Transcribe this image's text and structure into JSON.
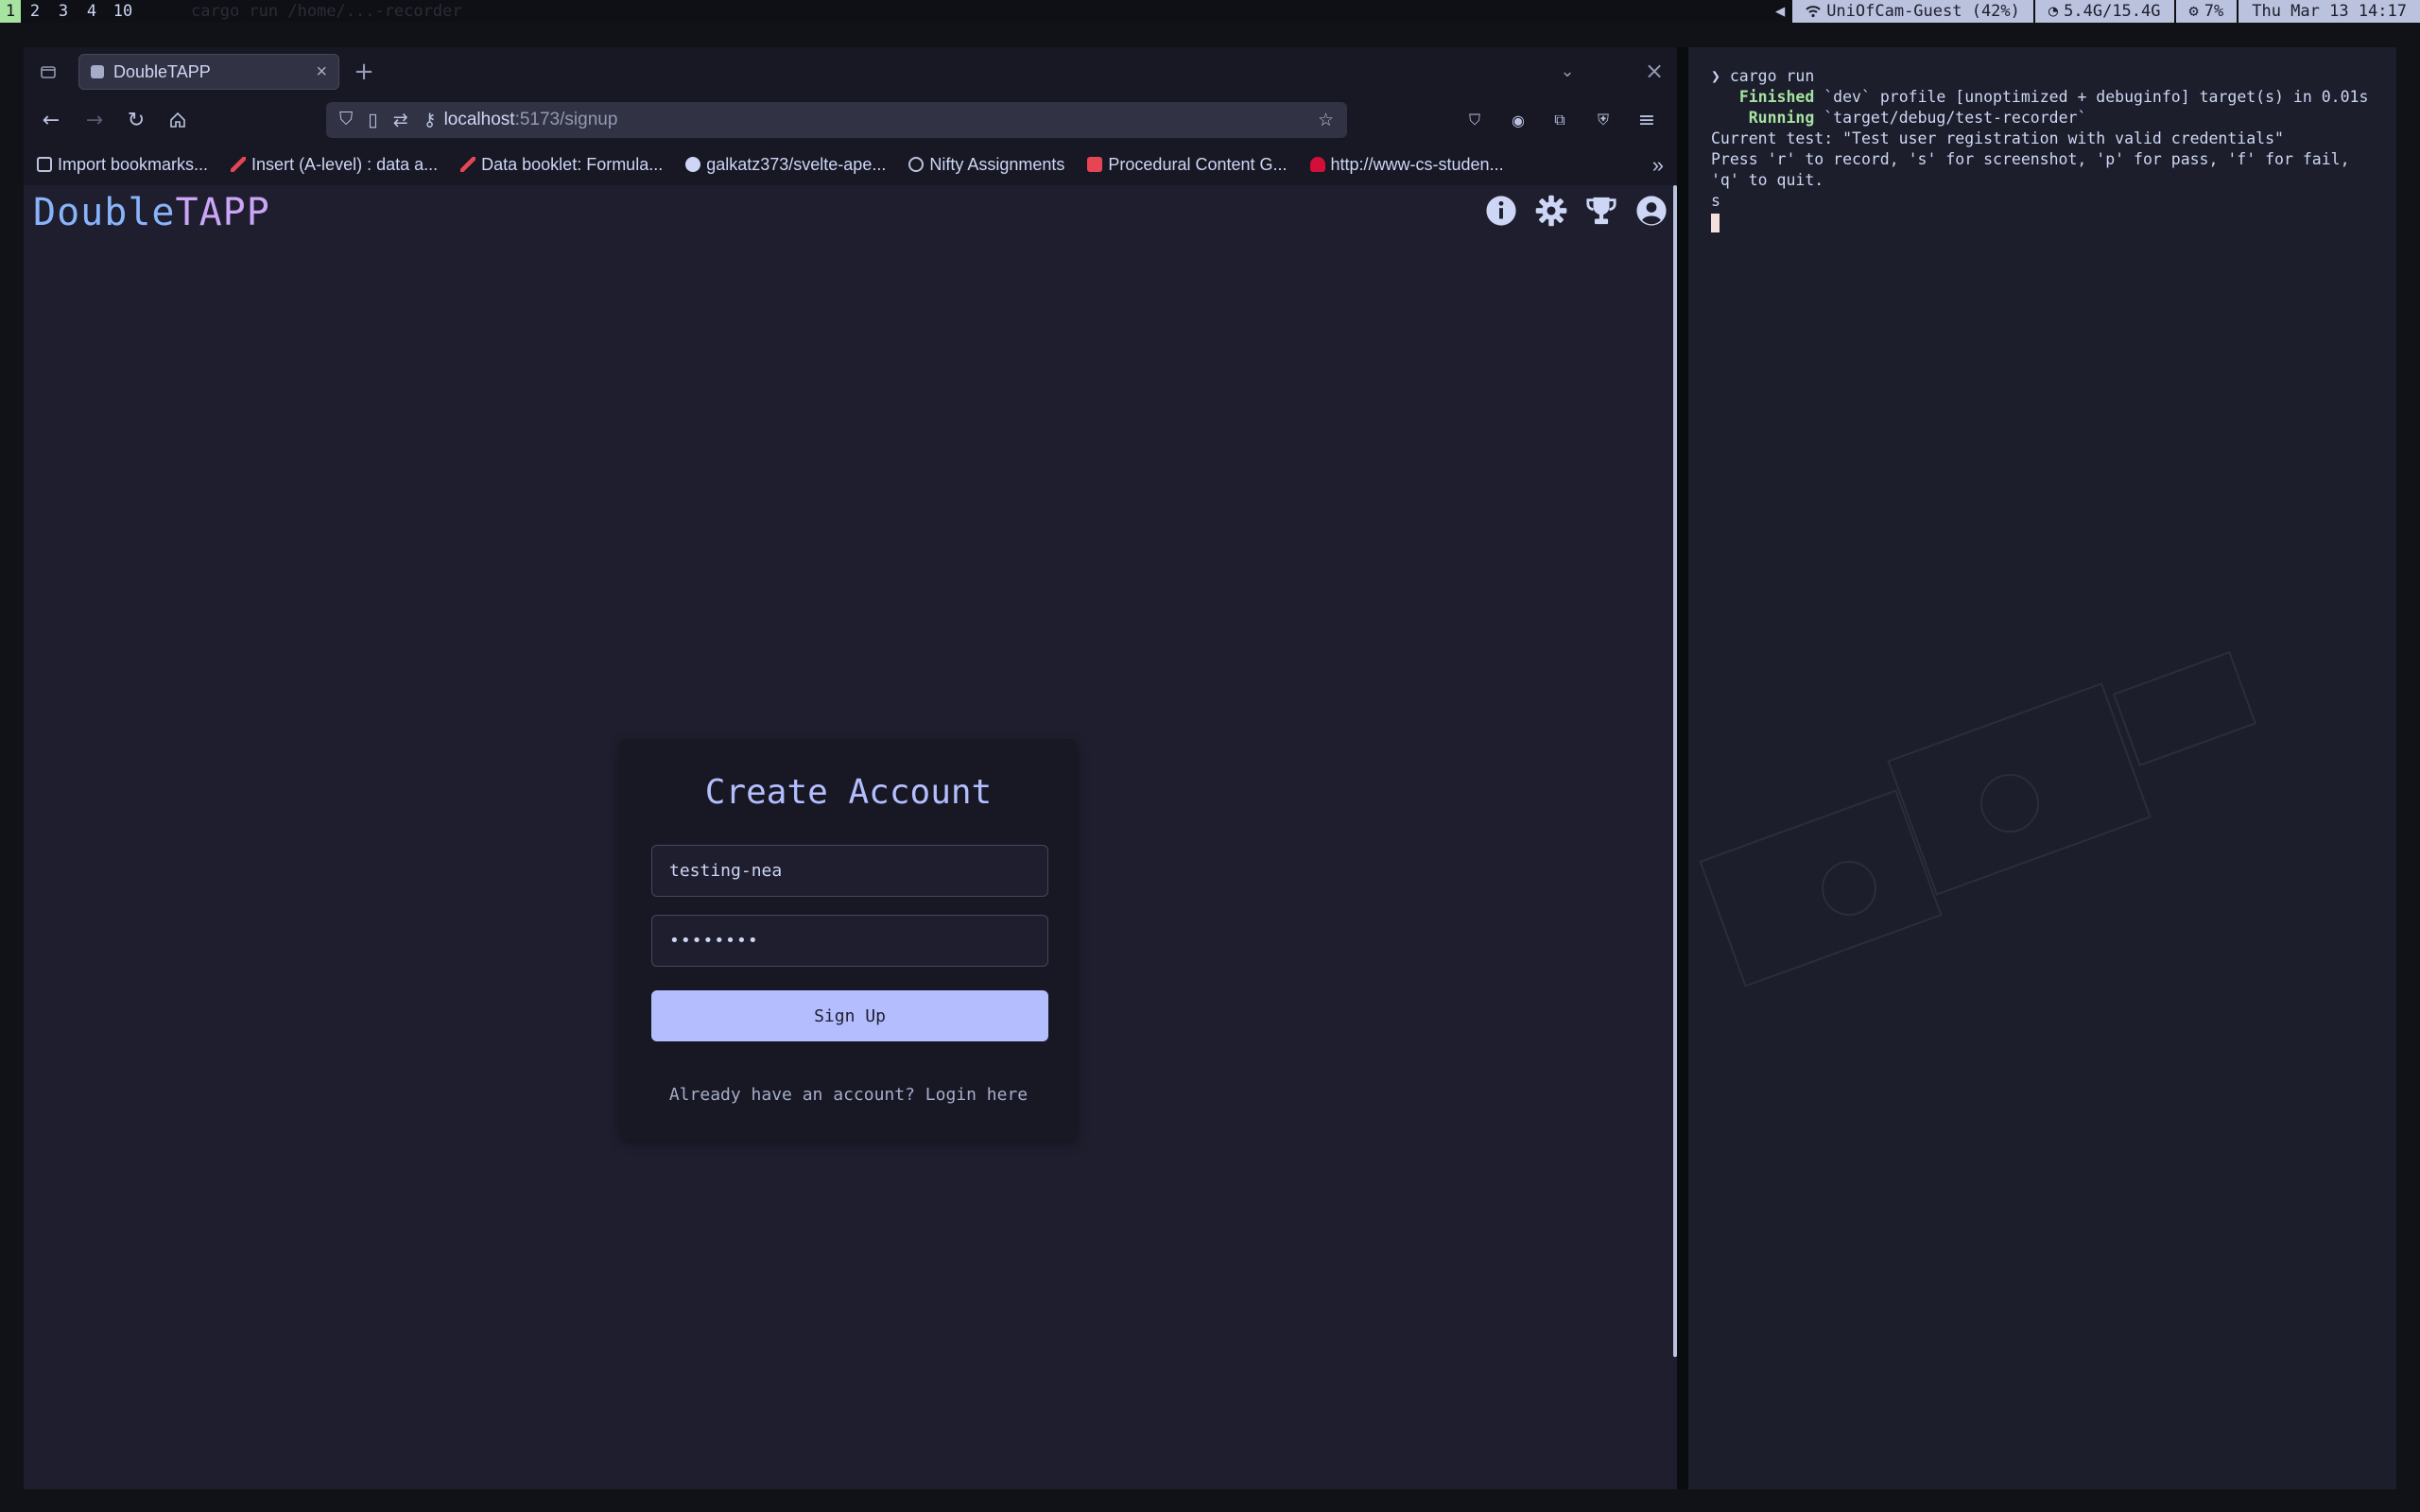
{
  "statusbar": {
    "workspaces": [
      "1",
      "2",
      "3",
      "4",
      "10"
    ],
    "active_workspace": "1",
    "window_title": "cargo run /home/...-recorder",
    "volume_icon": "speaker-icon",
    "wifi": "UniOfCam-Guest (42%)",
    "memory": "5.4G/15.4G",
    "cpu": "7%",
    "datetime": "Thu Mar 13 14:17"
  },
  "browser": {
    "tab_title": "DoubleTAPP",
    "url_host": "localhost",
    "url_path": ":5173/signup",
    "bookmarks": [
      {
        "label": "Import bookmarks...",
        "icon": "import-icon"
      },
      {
        "label": "Insert (A-level) : data a...",
        "icon": "bookmark-red-icon"
      },
      {
        "label": "Data booklet: Formula...",
        "icon": "bookmark-red-icon"
      },
      {
        "label": "galkatz373/svelte-ape...",
        "icon": "github-icon"
      },
      {
        "label": "Nifty Assignments",
        "icon": "globe-icon"
      },
      {
        "label": "Procedural Content G...",
        "icon": "pcg-icon"
      },
      {
        "label": "http://www-cs-studen...",
        "icon": "hat-icon"
      }
    ]
  },
  "app": {
    "logo_part1": "Double",
    "logo_part2": "TAPP",
    "header_icons": [
      "info-icon",
      "settings-icon",
      "trophy-icon",
      "account-icon"
    ],
    "form": {
      "title": "Create Account",
      "username_value": "testing-nea",
      "password_value": "••••••••",
      "submit_label": "Sign Up",
      "login_text": "Already have an account? Login here"
    }
  },
  "terminal": {
    "prompt_symbol": "❯",
    "command": "cargo run",
    "lines": [
      {
        "label": "Finished",
        "text": " `dev` profile [unoptimized + debuginfo] target(s) in 0.01s"
      },
      {
        "label": "Running",
        "text": " `target/debug/test-recorder`"
      }
    ],
    "current_test": "Current test: \"Test user registration with valid credentials\"",
    "instructions": "Press 'r' to record, 's' for screenshot, 'p' for pass, 'f' for fail, 'q' to quit.",
    "typed": "s"
  },
  "colors": {
    "accent": "#b4befe",
    "logo_blue": "#89b4fa",
    "logo_purple": "#cba6f7",
    "page_bg": "#1e1e2e",
    "terminal_green": "#a6e3a1"
  }
}
